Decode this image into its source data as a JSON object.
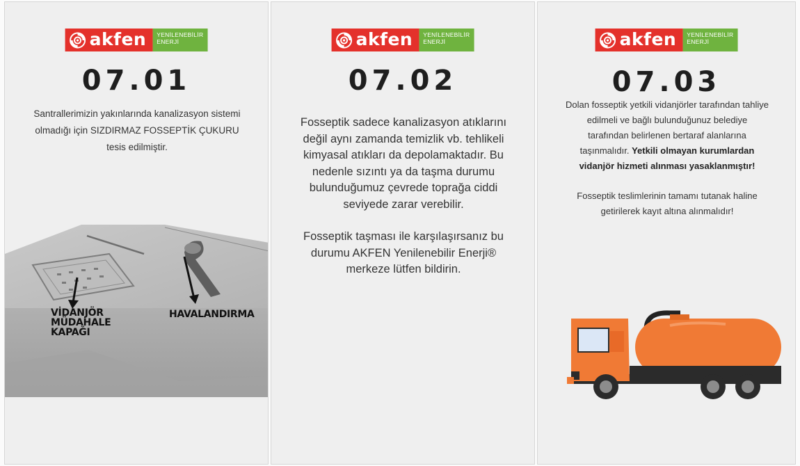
{
  "brand": {
    "word": "akfen",
    "tagline_line1": "YENİLENEBİLİR",
    "tagline_line2": "ENERJİ"
  },
  "colors": {
    "brand_red": "#e4312b",
    "brand_green": "#6fb33f",
    "truck_orange": "#f07a35",
    "panel_bg": "#efefef"
  },
  "panels": [
    {
      "code": "07.01",
      "text": "Santrallerimizin yakınlarında kanalizasyon sistemi olmadığı için SIZDIRMAZ FOSSEPTİK ÇUKURU tesis edilmiştir.",
      "labels": {
        "kapak_line1": "VİDANJÖR",
        "kapak_line2": "MÜDAHALE",
        "kapak_line3": "KAPAĞI",
        "havalandirma": "HAVALANDIRMA"
      }
    },
    {
      "code": "07.02",
      "paragraph1": "Fosseptik sadece kanalizasyon atıklarını değil aynı zamanda temizlik  vb. tehlikeli kimyasal atıkları da depolamaktadır. Bu nedenle sızıntı ya da taşma durumu bulunduğumuz çevrede toprağa ciddi seviyede zarar verebilir.",
      "paragraph2": "Fosseptik taşması ile karşılaşırsanız bu durumu AKFEN Yenilenebilir Enerji® merkeze lütfen bildirin."
    },
    {
      "code": "07.03",
      "paragraph1_normal": "Dolan fosseptik yetkili vidanjörler tarafından tahliye edilmeli ve bağlı bulunduğunuz belediye tarafından belirlenen bertaraf alanlarına taşınmalıdır. ",
      "paragraph1_bold": "Yetkili olmayan kurumlardan vidanjör hizmeti alınması yasaklanmıştır!",
      "paragraph2": "Fosseptik teslimlerinin tamamı tutanak haline getirilerek kayıt altına alınmalıdır!"
    }
  ],
  "icons": [
    "akfen-logo-mark-icon",
    "septic-tank-illustration",
    "vacuum-truck-icon"
  ]
}
